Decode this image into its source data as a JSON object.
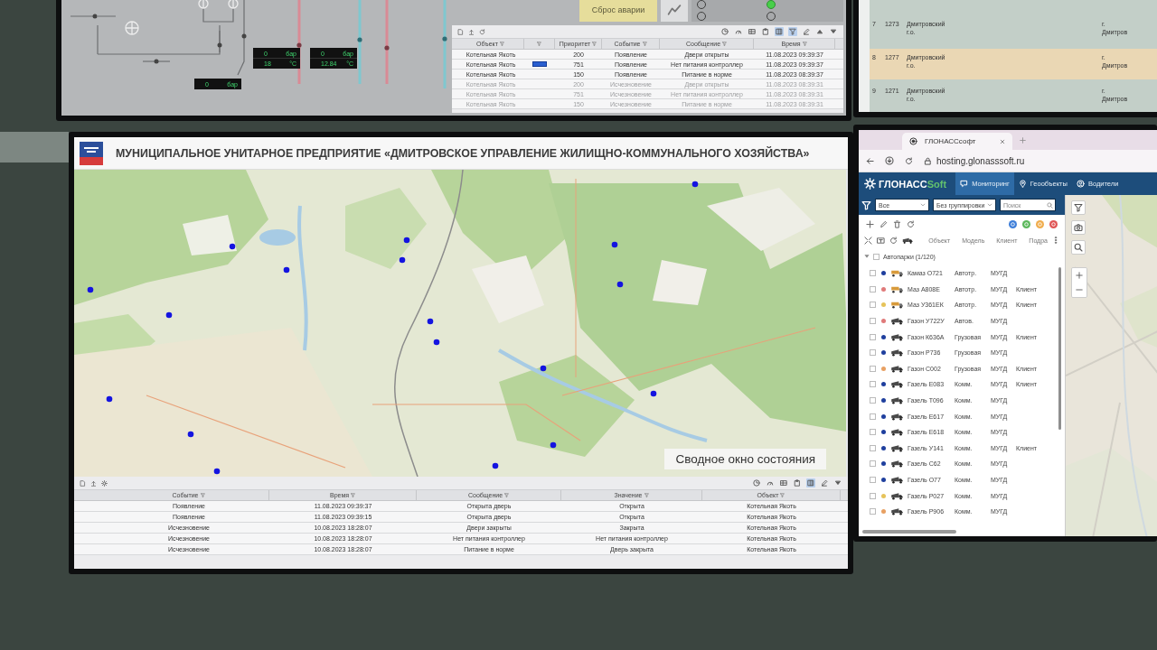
{
  "scada_screen": {
    "gauges": [
      {
        "rows": [
          {
            "value": "0",
            "unit": "бар"
          },
          {
            "value": "18",
            "unit": "°C"
          }
        ]
      },
      {
        "rows": [
          {
            "value": "0",
            "unit": "бар"
          },
          {
            "value": "12.84",
            "unit": "°C"
          }
        ]
      },
      {
        "rows": [
          {
            "value": "0",
            "unit": "бар"
          }
        ]
      }
    ],
    "reset_button": "Сброс аварии",
    "indicators": [
      {
        "on": false
      },
      {
        "on": true
      },
      {
        "on": false
      },
      {
        "on": false
      }
    ],
    "events": {
      "tools": [
        {
          "kind": "clock",
          "on": false
        },
        {
          "kind": "gauge",
          "on": false
        },
        {
          "kind": "table",
          "on": false
        },
        {
          "kind": "clipboard",
          "on": false
        },
        {
          "kind": "columns",
          "on": true
        },
        {
          "kind": "filter",
          "on": true
        },
        {
          "kind": "edit",
          "on": false
        },
        {
          "kind": "caret_up",
          "on": false
        },
        {
          "kind": "caret_down",
          "on": false
        }
      ],
      "columns": [
        "Объект",
        "Приоритет",
        "Событие",
        "Сообщение",
        "Время"
      ],
      "rows": [
        {
          "object": "Котельная Якоть",
          "flagged": false,
          "priority": "200",
          "event": "Появление",
          "message": "Двери открыты",
          "time": "11.08.2023 09:39:37",
          "active": true
        },
        {
          "object": "Котельная Якоть",
          "flagged": true,
          "priority": "751",
          "event": "Появление",
          "message": "Нет питания контроллер",
          "time": "11.08.2023 09:39:37",
          "active": true
        },
        {
          "object": "Котельная Якоть",
          "flagged": false,
          "priority": "150",
          "event": "Появление",
          "message": "Питание в норме",
          "time": "11.08.2023 08:39:37",
          "active": true
        },
        {
          "object": "Котельная Якоть",
          "flagged": false,
          "priority": "200",
          "event": "Исчезновение",
          "message": "Двери открыты",
          "time": "11.08.2023 08:39:31",
          "active": false
        },
        {
          "object": "Котельная Якоть",
          "flagged": false,
          "priority": "751",
          "event": "Исчезновение",
          "message": "Нет питания контроллер",
          "time": "11.08.2023 08:39:31",
          "active": false
        },
        {
          "object": "Котельная Якоть",
          "flagged": false,
          "priority": "150",
          "event": "Исчезновение",
          "message": "Питание в норме",
          "time": "11.08.2023 08:39:31",
          "active": false
        }
      ]
    }
  },
  "register_screen": {
    "rows": [
      {
        "number": "7",
        "code": "1273",
        "district": "Дмитровский г.о.",
        "city": "г. Дмитров",
        "highlighted": false
      },
      {
        "number": "8",
        "code": "1277",
        "district": "Дмитровский г.о.",
        "city": "г. Дмитров",
        "highlighted": true
      },
      {
        "number": "9",
        "code": "1271",
        "district": "Дмитровский г.о.",
        "city": "г. Дмитров",
        "highlighted": false
      }
    ]
  },
  "main_screen": {
    "title": "МУНИЦИПАЛЬНОЕ УНИТАРНОЕ ПРЕДПРИЯТИЕ «ДМИТРОВСКОЕ УПРАВЛЕНИЕ ЖИЛИЩНО-КОММУНАЛЬНОГО ХОЗЯЙСТВА»",
    "map_label": "Сводное окно состояния",
    "events": {
      "tools": [
        {
          "kind": "clock",
          "on": false
        },
        {
          "kind": "gauge",
          "on": false
        },
        {
          "kind": "table",
          "on": false
        },
        {
          "kind": "clipboard",
          "on": false
        },
        {
          "kind": "columns",
          "on": true
        },
        {
          "kind": "edit",
          "on": false
        },
        {
          "kind": "caret_down",
          "on": false
        }
      ],
      "columns": [
        "Событие",
        "Время",
        "Сообщение",
        "Значение",
        "Объект"
      ],
      "rows": [
        {
          "event": "Появление",
          "time": "11.08.2023 09:39:37",
          "message": "Открыта дверь",
          "value": "Открыта",
          "object": "Котельная Якоть"
        },
        {
          "event": "Появление",
          "time": "11.08.2023 09:39:15",
          "message": "Открыта дверь",
          "value": "Открыта",
          "object": "Котельная Якоть"
        },
        {
          "event": "Исчезновение",
          "time": "10.08.2023 18:28:07",
          "message": "Двери закрыты",
          "value": "Закрыта",
          "object": "Котельная Якоть"
        },
        {
          "event": "Исчезновение",
          "time": "10.08.2023 18:28:07",
          "message": "Нет питания контроллер",
          "value": "Нет питания контроллер",
          "object": "Котельная Якоть"
        },
        {
          "event": "Исчезновение",
          "time": "10.08.2023 18:28:07",
          "message": "Питание в норме",
          "value": "Дверь закрыта",
          "object": "Котельная Якоть"
        }
      ]
    }
  },
  "glonass_screen": {
    "browser_tab": "ГЛОНАССсофт",
    "url": "hosting.glonasssoft.ru",
    "logo": {
      "text": "ГЛОНАСС",
      "accent": "Soft"
    },
    "nav": [
      {
        "label": "Мониторинг",
        "selected": true
      },
      {
        "label": "Геообъекты",
        "selected": false
      },
      {
        "label": "Водители",
        "selected": false
      }
    ],
    "filters": {
      "group": "Все",
      "grouping": "Без группировки",
      "search_placeholder": "Поиск"
    },
    "status_filters": [
      {
        "color": "#3f7fd9"
      },
      {
        "color": "#5cb85c"
      },
      {
        "color": "#f0ad4e"
      },
      {
        "color": "#e05555"
      }
    ],
    "columns": [
      "Объект",
      "Модель",
      "Клиент",
      "Подра"
    ],
    "group": {
      "label": "Автопарки (1/120)",
      "expanded": true,
      "checked": false
    },
    "vehicles": [
      {
        "name": "Камаз О721",
        "type": "Автотр.",
        "org": "МУГД",
        "kind": "tipper",
        "color": "#1f3f9e",
        "checked": false
      },
      {
        "name": "Маз А808Е",
        "type": "Автотр.",
        "org": "МУГД",
        "client": "Клиент",
        "kind": "tipper",
        "color": "#e07a7a",
        "checked": false
      },
      {
        "name": "Маз У361ЕК",
        "type": "Автотр.",
        "org": "МУГД",
        "client": "Клиент",
        "kind": "tipper",
        "color": "#e6c35a",
        "checked": false
      },
      {
        "name": "Газон У722У",
        "type": "Автов.",
        "org": "МУГД",
        "kind": "truck",
        "color": "#e07a7a",
        "checked": false
      },
      {
        "name": "Газон К636А",
        "type": "Грузовая",
        "org": "МУГД",
        "client": "Клиент",
        "kind": "truck",
        "color": "#1f3f9e",
        "checked": false
      },
      {
        "name": "Газон Р736",
        "type": "Грузовая",
        "org": "МУГД",
        "kind": "truck",
        "color": "#1f3f9e",
        "checked": false
      },
      {
        "name": "Газон С002",
        "type": "Грузовая",
        "org": "МУГД",
        "client": "Клиент",
        "kind": "truck",
        "color": "#e8a062",
        "checked": false
      },
      {
        "name": "Газель Е083",
        "type": "Комм.",
        "org": "МУГД",
        "client": "Клиент",
        "kind": "truck",
        "color": "#1f3f9e",
        "checked": false
      },
      {
        "name": "Газель Т096",
        "type": "Комм.",
        "org": "МУГД",
        "kind": "truck",
        "color": "#1f3f9e",
        "checked": false
      },
      {
        "name": "Газель Е617",
        "type": "Комм.",
        "org": "МУГД",
        "kind": "truck",
        "color": "#1f3f9e",
        "checked": false
      },
      {
        "name": "Газель Е618",
        "type": "Комм.",
        "org": "МУГД",
        "kind": "truck",
        "color": "#1f3f9e",
        "checked": false
      },
      {
        "name": "Газель У141",
        "type": "Комм.",
        "org": "МУГД",
        "client": "Клиент",
        "kind": "truck",
        "color": "#1f3f9e",
        "checked": false
      },
      {
        "name": "Газель С62",
        "type": "Комм.",
        "org": "МУГД",
        "kind": "truck",
        "color": "#1f3f9e",
        "checked": false
      },
      {
        "name": "Газель О77",
        "type": "Комм.",
        "org": "МУГД",
        "kind": "truck",
        "color": "#1f3f9e",
        "checked": false
      },
      {
        "name": "Газель Р027",
        "type": "Комм.",
        "org": "МУГД",
        "kind": "truck",
        "color": "#e6c35a",
        "checked": false
      },
      {
        "name": "Газель Р906",
        "type": "Комм.",
        "org": "МУГД",
        "kind": "truck",
        "color": "#e8a062",
        "checked": false
      }
    ]
  }
}
